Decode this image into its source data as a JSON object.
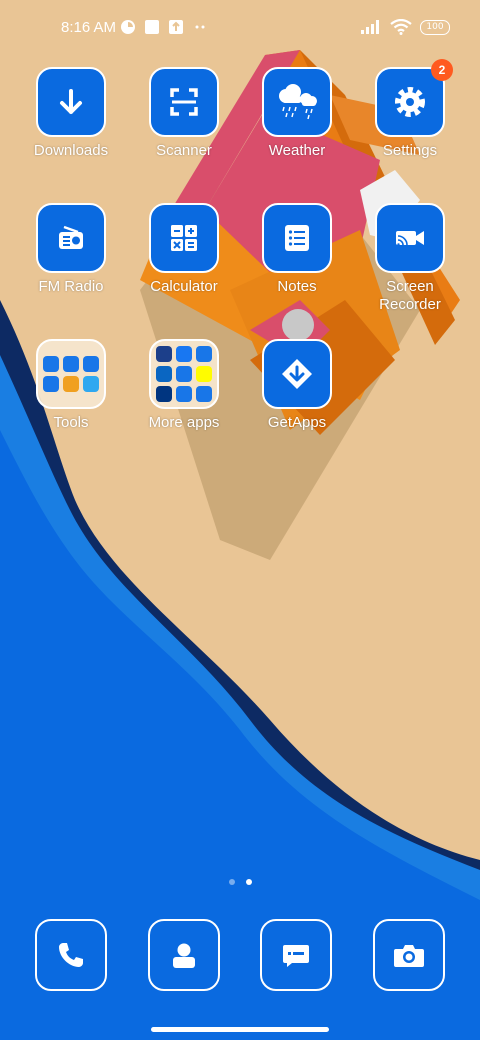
{
  "status": {
    "time": "8:16 AM",
    "battery": "100",
    "left_icons": [
      "data-saver-icon",
      "app-notification-icon",
      "upload-icon",
      "more-dots-icon"
    ],
    "right_icons": [
      "signal-icon",
      "wifi-icon",
      "battery-icon"
    ]
  },
  "apps": [
    {
      "label": "Downloads",
      "icon": "download-arrow-icon"
    },
    {
      "label": "Scanner",
      "icon": "scan-frame-icon"
    },
    {
      "label": "Weather",
      "icon": "rain-cloud-icon"
    },
    {
      "label": "Settings",
      "icon": "gear-icon",
      "badge": "2"
    },
    {
      "label": "FM Radio",
      "icon": "radio-icon"
    },
    {
      "label": "Calculator",
      "icon": "calculator-icon"
    },
    {
      "label": "Notes",
      "icon": "notes-list-icon"
    },
    {
      "label": "Screen\nRecorder",
      "icon": "video-camera-icon"
    },
    {
      "label": "Tools",
      "icon": "folder-icon"
    },
    {
      "label": "More apps",
      "icon": "folder-icon"
    },
    {
      "label": "GetApps",
      "icon": "getapps-diamond-icon"
    }
  ],
  "page_indicator": {
    "pages": 2,
    "active": 2
  },
  "dock": [
    {
      "icon": "phone-icon"
    },
    {
      "icon": "contacts-icon"
    },
    {
      "icon": "messages-icon"
    },
    {
      "icon": "camera-icon"
    }
  ],
  "colors": {
    "sand": "#e9c595",
    "blue": "#0a6ae0",
    "navy": "#0d2a63",
    "badge": "#ff5a1f"
  }
}
